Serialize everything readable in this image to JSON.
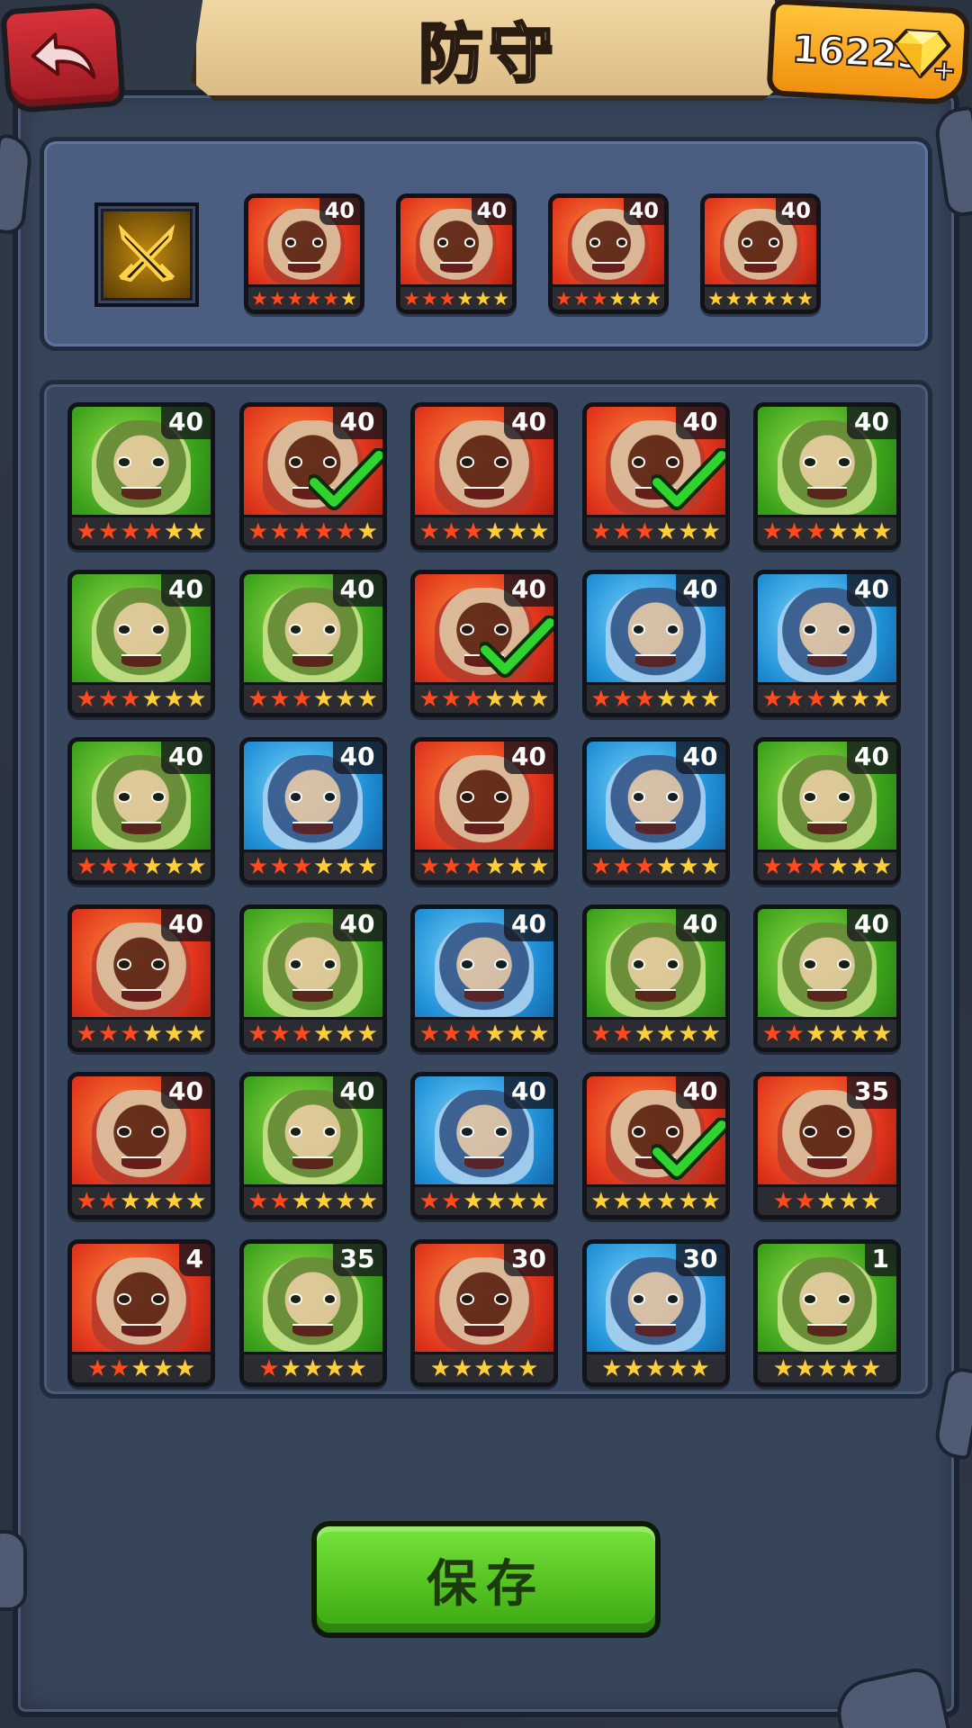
{
  "header": {
    "title": "防守",
    "currency_amount": "16223",
    "currency_icon": "diamond-gem-icon",
    "add_icon": "plus-icon",
    "back_icon": "back-arrow-icon"
  },
  "defense_team": {
    "formation_icon": "crossed-swords-icon",
    "heroes": [
      {
        "level": "40",
        "color": "red",
        "stars": 6,
        "red_stars": 5
      },
      {
        "level": "40",
        "color": "red",
        "stars": 6,
        "red_stars": 3
      },
      {
        "level": "40",
        "color": "red",
        "stars": 6,
        "red_stars": 3
      },
      {
        "level": "40",
        "color": "red",
        "stars": 6,
        "red_stars": 0
      }
    ]
  },
  "roster": {
    "heroes": [
      {
        "level": "40",
        "color": "green",
        "stars": 6,
        "red_stars": 4,
        "selected": false
      },
      {
        "level": "40",
        "color": "red",
        "stars": 6,
        "red_stars": 5,
        "selected": true
      },
      {
        "level": "40",
        "color": "red",
        "stars": 6,
        "red_stars": 3,
        "selected": false
      },
      {
        "level": "40",
        "color": "red",
        "stars": 6,
        "red_stars": 3,
        "selected": true
      },
      {
        "level": "40",
        "color": "green",
        "stars": 6,
        "red_stars": 3,
        "selected": false
      },
      {
        "level": "40",
        "color": "green",
        "stars": 6,
        "red_stars": 3,
        "selected": false
      },
      {
        "level": "40",
        "color": "green",
        "stars": 6,
        "red_stars": 3,
        "selected": false
      },
      {
        "level": "40",
        "color": "red",
        "stars": 6,
        "red_stars": 3,
        "selected": true
      },
      {
        "level": "40",
        "color": "blue",
        "stars": 6,
        "red_stars": 3,
        "selected": false
      },
      {
        "level": "40",
        "color": "blue",
        "stars": 6,
        "red_stars": 3,
        "selected": false
      },
      {
        "level": "40",
        "color": "green",
        "stars": 6,
        "red_stars": 3,
        "selected": false
      },
      {
        "level": "40",
        "color": "blue",
        "stars": 6,
        "red_stars": 3,
        "selected": false
      },
      {
        "level": "40",
        "color": "red",
        "stars": 6,
        "red_stars": 3,
        "selected": false
      },
      {
        "level": "40",
        "color": "blue",
        "stars": 6,
        "red_stars": 3,
        "selected": false
      },
      {
        "level": "40",
        "color": "green",
        "stars": 6,
        "red_stars": 3,
        "selected": false
      },
      {
        "level": "40",
        "color": "red",
        "stars": 6,
        "red_stars": 3,
        "selected": false
      },
      {
        "level": "40",
        "color": "green",
        "stars": 6,
        "red_stars": 3,
        "selected": false
      },
      {
        "level": "40",
        "color": "blue",
        "stars": 6,
        "red_stars": 3,
        "selected": false
      },
      {
        "level": "40",
        "color": "green",
        "stars": 6,
        "red_stars": 2,
        "selected": false
      },
      {
        "level": "40",
        "color": "green",
        "stars": 6,
        "red_stars": 2,
        "selected": false
      },
      {
        "level": "40",
        "color": "red",
        "stars": 6,
        "red_stars": 2,
        "selected": false
      },
      {
        "level": "40",
        "color": "green",
        "stars": 6,
        "red_stars": 2,
        "selected": false
      },
      {
        "level": "40",
        "color": "blue",
        "stars": 6,
        "red_stars": 2,
        "selected": false
      },
      {
        "level": "40",
        "color": "red",
        "stars": 6,
        "red_stars": 0,
        "selected": true
      },
      {
        "level": "35",
        "color": "red",
        "stars": 5,
        "red_stars": 2,
        "selected": false
      },
      {
        "level": "4",
        "color": "red",
        "stars": 5,
        "red_stars": 2,
        "selected": false
      },
      {
        "level": "35",
        "color": "green",
        "stars": 5,
        "red_stars": 1,
        "selected": false
      },
      {
        "level": "30",
        "color": "red",
        "stars": 5,
        "red_stars": 0,
        "selected": false
      },
      {
        "level": "30",
        "color": "blue",
        "stars": 5,
        "red_stars": 0,
        "selected": false
      },
      {
        "level": "1",
        "color": "green",
        "stars": 5,
        "red_stars": 0,
        "selected": false
      }
    ]
  },
  "save_button": {
    "label": "保存"
  },
  "colors": {
    "star_gold": "#ffcf3a",
    "star_red": "#ff4a1e",
    "check_green": "#2fd42f",
    "save_green": "#4cc01e"
  }
}
